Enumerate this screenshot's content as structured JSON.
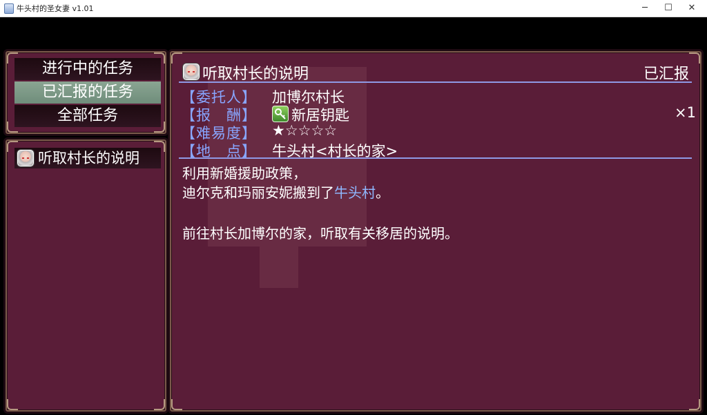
{
  "window": {
    "title": "牛头村的圣女妻 v1.01",
    "min_glyph": "─",
    "max_glyph": "☐",
    "close_glyph": "✕"
  },
  "categories": [
    {
      "label": "进行中的任务",
      "selected": false
    },
    {
      "label": "已汇报的任务",
      "selected": true
    },
    {
      "label": "全部任务",
      "selected": false
    }
  ],
  "quest_list": [
    {
      "title": "听取村长的说明",
      "icon": "elder-avatar-icon"
    }
  ],
  "detail": {
    "title": "听取村长的说明",
    "status": "已汇报",
    "client_label": "【委托人】",
    "client_value": "加博尔村长",
    "reward_label": "【报　酬】",
    "reward_value": "新居钥匙",
    "reward_icon": "key-icon",
    "reward_qty": "×1",
    "difficulty_label": "【难易度】",
    "difficulty_value": "★☆☆☆☆",
    "location_label": "【地　点】",
    "location_value": "牛头村<村长的家>",
    "desc_line1": "利用新婚援助政策，",
    "desc_line2_pre": "迪尔克和玛丽安妮搬到了",
    "desc_line2_highlight": "牛头村",
    "desc_line2_post": "。",
    "desc_line3": "前往村长加博尔的家，听取有关移居的说明。"
  },
  "colors": {
    "panel": "#5a1d38",
    "label_blue": "#88a6ff",
    "highlight_blue": "#8fb8ff",
    "selected_item": "#7d9a87",
    "rule_line": "#8f9ae6"
  }
}
